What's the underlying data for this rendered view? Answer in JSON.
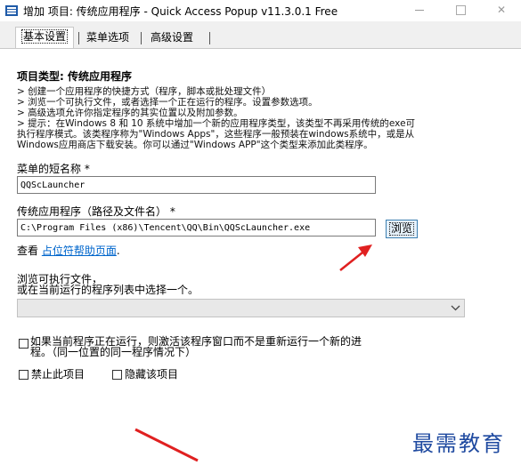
{
  "window": {
    "title": "增加 项目: 传统应用程序 - Quick Access Popup v11.3.0.1 Free",
    "minimize_glyph": "—",
    "close_glyph": "✕"
  },
  "tabs": [
    {
      "label": "基本设置",
      "active": true
    },
    {
      "label": "菜单选项",
      "active": false
    },
    {
      "label": "高级设置",
      "active": false
    }
  ],
  "form": {
    "heading": "项目类型:  传统应用程序",
    "description": [
      "> 创建一个应用程序的快捷方式（程序，脚本或批处理文件）",
      "> 浏览一个可执行文件，或者选择一个正在运行的程序。设置参数选项。",
      "> 高级选项允许你指定程序的其实位置以及附加参数。",
      "> 提示：在Windows 8 和 10 系统中增加一个新的应用程序类型，该类型不再采用传统的exe可",
      "执行程序模式。该类程序称为\"Windows Apps\"，这些程序一般预装在windows系统中，或是从",
      "Windows应用商店下载安装。你可以通过\"Windows APP\"这个类型来添加此类程序。"
    ],
    "short_name_label": "菜单的短名称 *",
    "short_name_value": "QQScLauncher",
    "path_label": "传统应用程序（路径及文件名） *",
    "path_value": "C:\\Program Files (x86)\\Tencent\\QQ\\Bin\\QQScLauncher.exe",
    "browse_label": "浏览",
    "view_prefix": "查看",
    "help_link": "占位符帮助页面",
    "help_link_suffix": ".",
    "browse_hint_1": "浏览可执行文件，",
    "browse_hint_2": "或在当前运行的程序列表中选择一个。",
    "running_select_value": "",
    "activate_checkbox_1": "如果当前程序正在运行，则激活该程序窗口而不是重新运行一个新的进",
    "activate_checkbox_2": "程。（同一位置的同一程序情况下）",
    "disable_item_label": "禁止此项目",
    "hide_item_label": "隐藏该项目"
  },
  "watermark": "最需教育",
  "colors": {
    "arrow": "#e02020",
    "link": "#0066cc",
    "button_border": "#3c7fb1",
    "watermark": "#1f4aa0"
  },
  "icons": {
    "app": "quick-access-popup-icon",
    "dropdown": "chevron-down-icon"
  }
}
